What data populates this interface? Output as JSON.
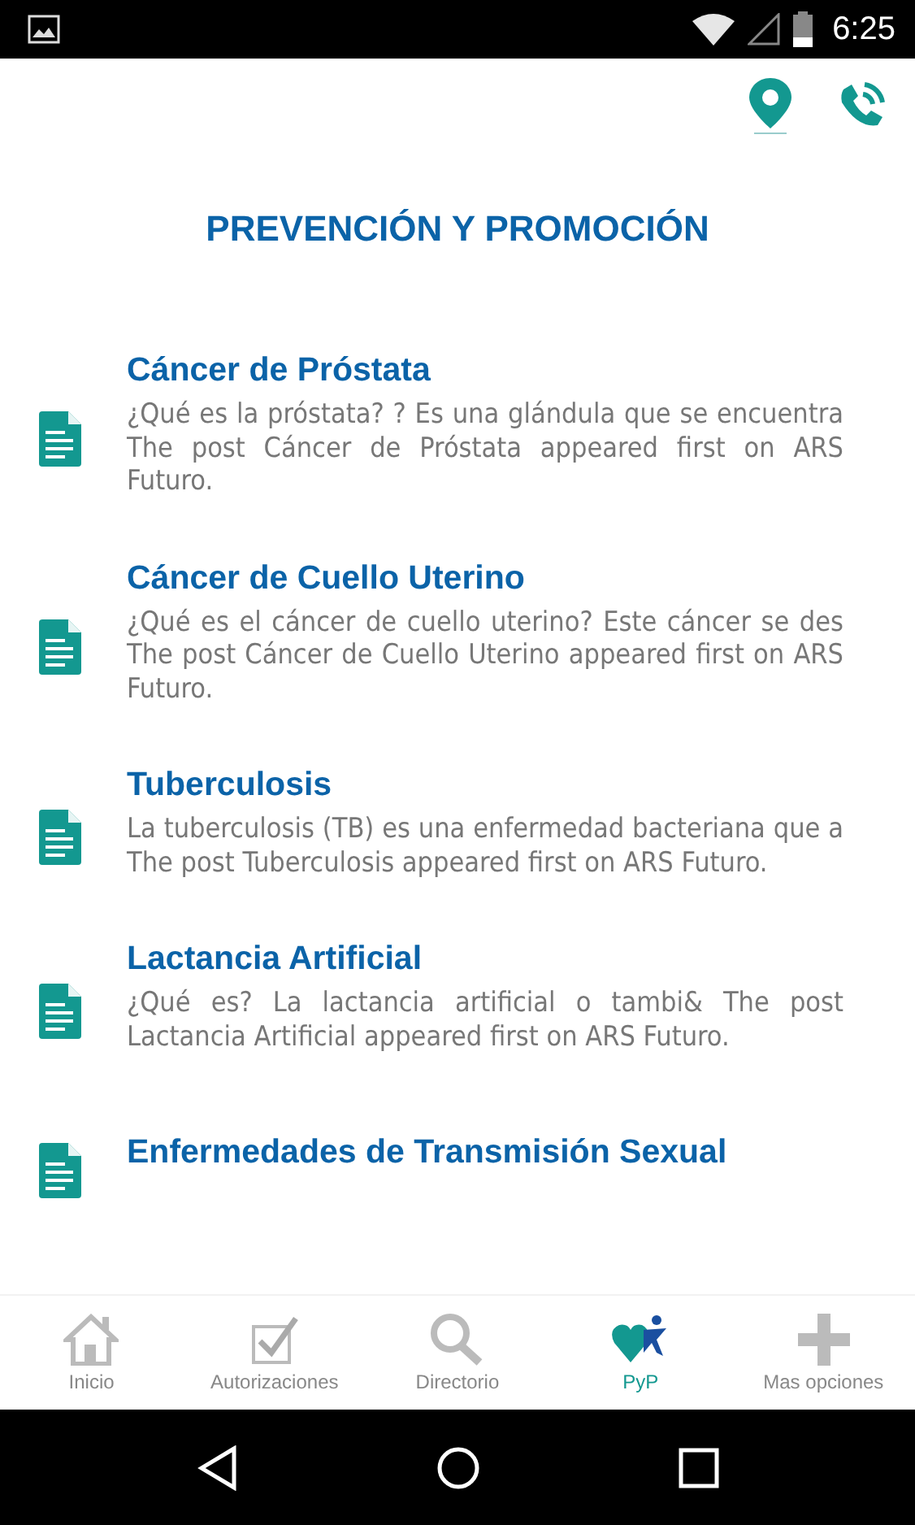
{
  "status_bar": {
    "time": "6:25"
  },
  "page": {
    "title": "PREVENCIÓN Y PROMOCIÓN"
  },
  "posts": [
    {
      "title": "Cáncer de Próstata",
      "excerpt": "¿Qué es la próstata? ? Es una glándula que se encuentra The post Cáncer de Próstata appeared first on ARS Futuro."
    },
    {
      "title": "Cáncer de Cuello Uterino",
      "excerpt": "¿Qué es el cáncer de cuello uterino? Este cáncer se des The post Cáncer de Cuello Uterino appeared first on ARS Futuro."
    },
    {
      "title": "Tuberculosis",
      "excerpt": "La tuberculosis (TB) es una enfermedad bacteriana que a The post Tuberculosis appeared first on ARS Futuro."
    },
    {
      "title": "Lactancia Artificial",
      "excerpt": "¿Qué es? La lactancia artificial o tambi& The post Lactancia Artificial appeared first on ARS Futuro."
    },
    {
      "title": "Enfermedades de Transmisión Sexual"
    }
  ],
  "bottom_nav": [
    {
      "kind": "home",
      "label": "Inicio",
      "selected": false
    },
    {
      "kind": "check",
      "label": "Autorizaciones",
      "selected": false
    },
    {
      "kind": "search",
      "label": "Directorio",
      "selected": false
    },
    {
      "kind": "pyp",
      "label": "PyP",
      "selected": true
    },
    {
      "kind": "plus",
      "label": "Mas opciones",
      "selected": false
    }
  ]
}
